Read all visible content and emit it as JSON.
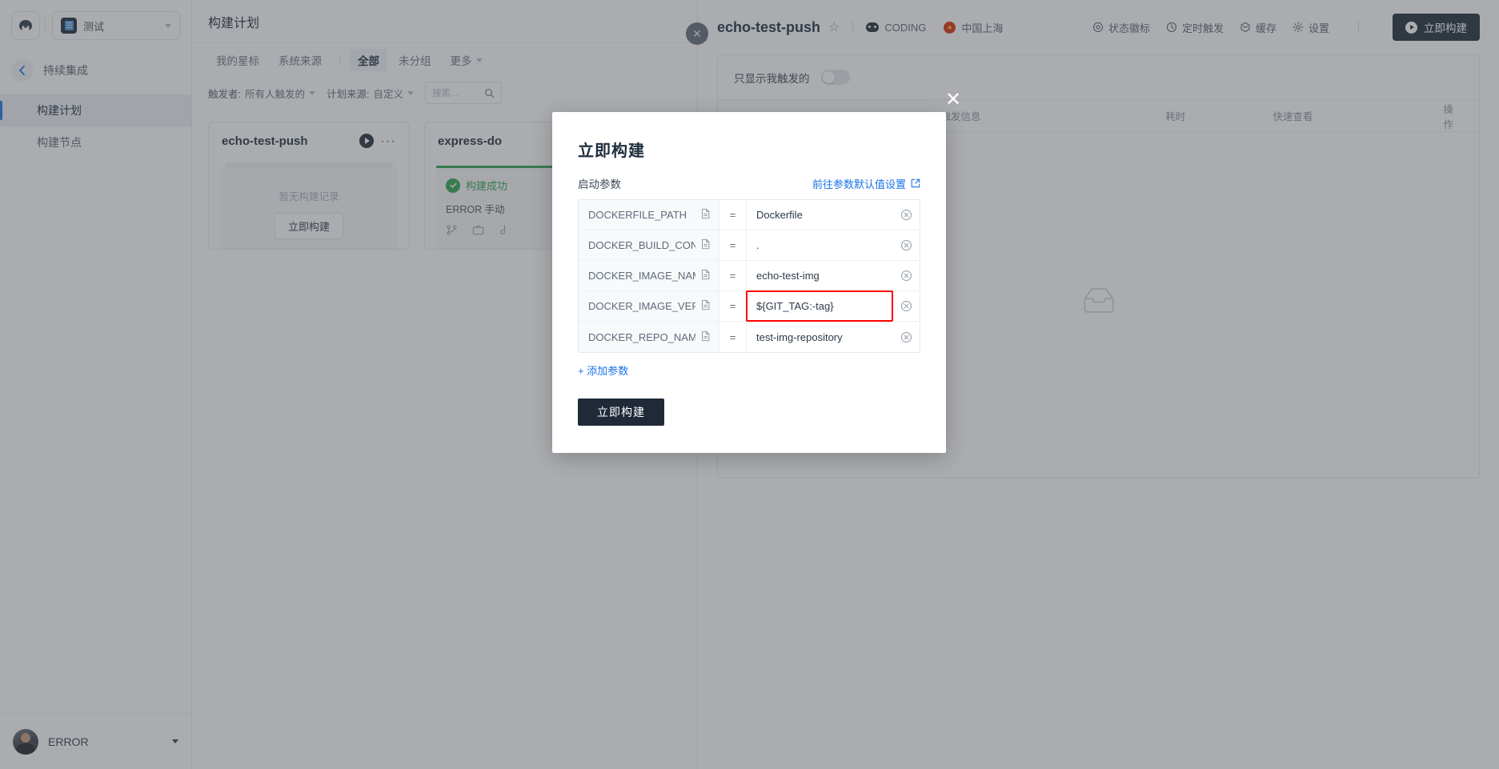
{
  "sidebar": {
    "logo_icon": "coding-logo-icon",
    "project": {
      "name": "测试",
      "icon": "project-square-icon"
    },
    "back": {
      "label": "持续集成",
      "icon": "arrow-left-icon"
    },
    "items": [
      {
        "label": "构建计划",
        "active": true
      },
      {
        "label": "构建节点",
        "active": false
      }
    ],
    "user": {
      "name": "ERROR"
    }
  },
  "middle": {
    "title": "构建计划",
    "tabs": [
      {
        "label": "我的星标",
        "strong": false
      },
      {
        "label": "系统来源",
        "strong": false
      },
      {
        "label": "全部",
        "strong": true
      },
      {
        "label": "未分组",
        "strong": false
      },
      {
        "label": "更多",
        "strong": false
      }
    ],
    "filters": {
      "trigger_label": "触发者:",
      "trigger_value": "所有人触发的",
      "source_label": "计划来源:",
      "source_value": "自定义",
      "search_placeholder": "搜索...",
      "search_icon": "search-icon"
    },
    "cards": [
      {
        "title": "echo-test-push",
        "empty_text": "暂无构建记录",
        "button": "立即构建",
        "play_icon": "play-circle-icon",
        "more_icon": "more-horizontal-icon"
      },
      {
        "title": "express-do",
        "status": "构建成功",
        "sub": "ERROR 手动",
        "status_icon": "check-circle-icon"
      }
    ]
  },
  "right": {
    "title": "echo-test-push",
    "star_icon": "star-outline-icon",
    "meta": [
      {
        "icon": "coding-icon",
        "label": "CODING"
      },
      {
        "icon": "flag-cn-icon",
        "label": "中国上海"
      }
    ],
    "actions": [
      {
        "icon": "badge-icon",
        "label": "状态徽标"
      },
      {
        "icon": "clock-icon",
        "label": "定时触发"
      },
      {
        "icon": "cache-icon",
        "label": "缓存"
      },
      {
        "icon": "gear-icon",
        "label": "设置"
      }
    ],
    "build_button": {
      "label": "立即构建",
      "icon": "play-circle-icon"
    },
    "toggle": {
      "label": "只显示我触发的",
      "on": false
    },
    "table_headers": [
      "触发信息",
      "耗时",
      "快速查看",
      "操作"
    ],
    "empty_icon": "empty-tray-icon",
    "collapse_icon": "close-circle-icon"
  },
  "modal": {
    "title": "立即构建",
    "section_label": "启动参数",
    "settings_link": "前往参数默认值设置",
    "settings_link_icon": "external-link-icon",
    "close_icon": "close-icon",
    "equals_sign": "=",
    "delete_icon": "delete-circle-icon",
    "file_icon": "file-icon",
    "params": [
      {
        "key": "DOCKERFILE_PATH",
        "value": "Dockerfile",
        "highlighted": false
      },
      {
        "key": "DOCKER_BUILD_CONT",
        "value": ".",
        "highlighted": false
      },
      {
        "key": "DOCKER_IMAGE_NAM",
        "value": "echo-test-img",
        "highlighted": false
      },
      {
        "key": "DOCKER_IMAGE_VERS",
        "value": "${GIT_TAG:-tag}",
        "highlighted": true
      },
      {
        "key": "DOCKER_REPO_NAME",
        "value": "test-img-repository",
        "highlighted": false
      }
    ],
    "add_param": "+ 添加参数",
    "submit": "立即构建"
  },
  "colors": {
    "accent_blue": "#1a73e8",
    "dark_button": "#1f2937",
    "success_green": "#2ea44f",
    "highlight_red": "#ff0000"
  }
}
